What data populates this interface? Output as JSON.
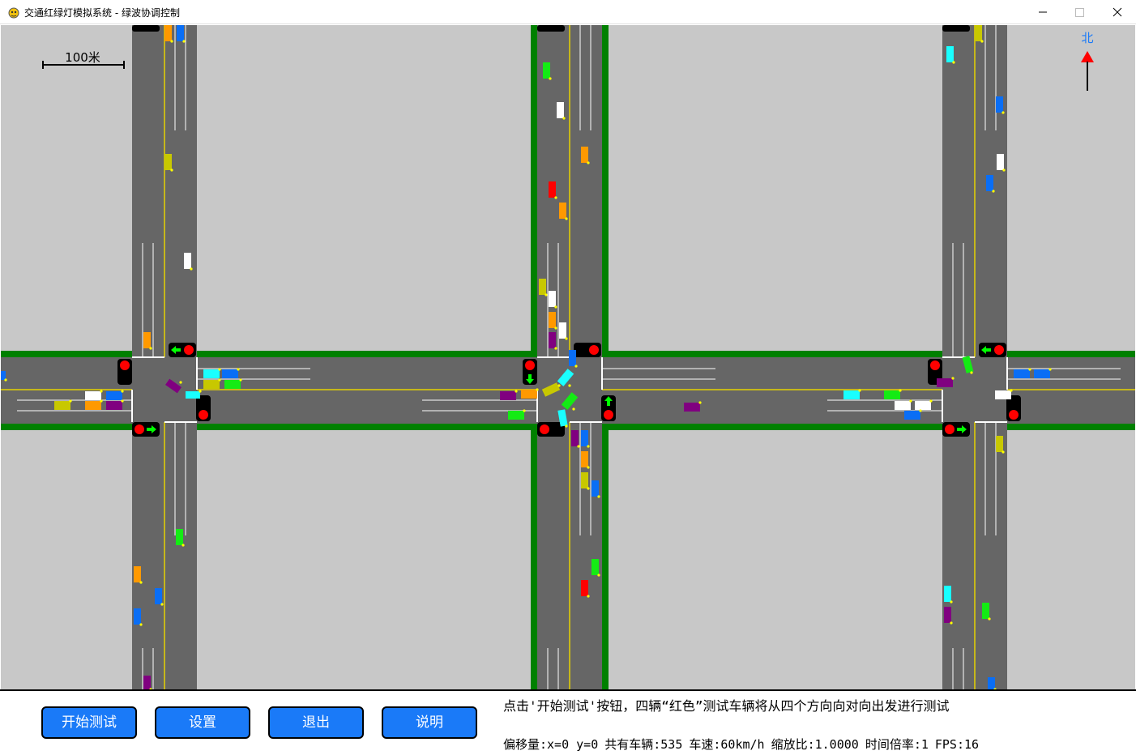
{
  "window": {
    "title": "交通红绿灯模拟系统 - 绿波协调控制"
  },
  "map": {
    "scale_label": "100米",
    "compass_label": "北"
  },
  "buttons": [
    {
      "label": "开始测试"
    },
    {
      "label": "设置"
    },
    {
      "label": "退出"
    },
    {
      "label": "说明"
    }
  ],
  "status": {
    "hint": "点击'开始测试'按钮，四辆“红色”测试车辆将从四个方向向对向出发进行测试",
    "offset": "偏移量:x=0 y=0",
    "vehicle_count": "共有车辆:535",
    "speed": "车速:60km/h",
    "zoom": "缩放比:1.0000",
    "time_rate": "时间倍率:1",
    "fps": "FPS:16"
  },
  "colors": {
    "road": "#666666",
    "block": "#c8c8c8",
    "greenbelt": "#008000",
    "center_line": "#e6d200",
    "button": "#1a7af8",
    "compass": "#1a7af8",
    "signal_red": "#ff0000",
    "signal_green": "#00ff00"
  },
  "vehicle_colors": {
    "orange": "#ff9900",
    "blue": "#0a6ef5",
    "green": "#14eb14",
    "white": "#ffffff",
    "yellow": "#c8c800",
    "red": "#ff0000",
    "cyan": "#19ffff",
    "purple": "#800080"
  }
}
